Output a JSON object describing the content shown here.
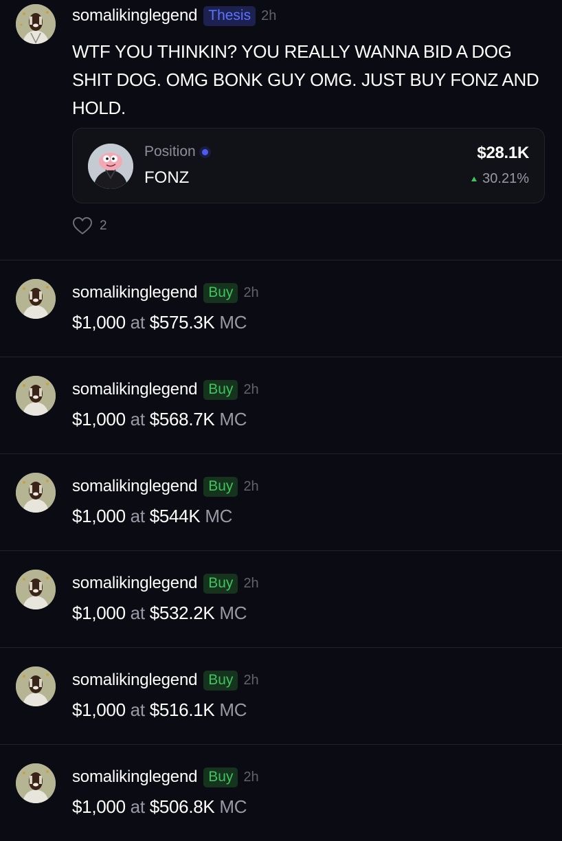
{
  "thesis_post": {
    "username": "somalikinglegend",
    "badge": "Thesis",
    "time": "2h",
    "text": "WTF YOU THINKIN? YOU REALLY WANNA BID A DOG SHIT DOG. OMG BONK GUY OMG. JUST BUY FONZ AND HOLD.",
    "position": {
      "label": "Position",
      "token": "FONZ",
      "value": "$28.1K",
      "change": "30.21%"
    },
    "likes": "2"
  },
  "trades": [
    {
      "username": "somalikinglegend",
      "badge": "Buy",
      "time": "2h",
      "amount": "$1,000",
      "at": "at",
      "mc": "$575.3K",
      "unit": "MC"
    },
    {
      "username": "somalikinglegend",
      "badge": "Buy",
      "time": "2h",
      "amount": "$1,000",
      "at": "at",
      "mc": "$568.7K",
      "unit": "MC"
    },
    {
      "username": "somalikinglegend",
      "badge": "Buy",
      "time": "2h",
      "amount": "$1,000",
      "at": "at",
      "mc": "$544K",
      "unit": "MC"
    },
    {
      "username": "somalikinglegend",
      "badge": "Buy",
      "time": "2h",
      "amount": "$1,000",
      "at": "at",
      "mc": "$532.2K",
      "unit": "MC"
    },
    {
      "username": "somalikinglegend",
      "badge": "Buy",
      "time": "2h",
      "amount": "$1,000",
      "at": "at",
      "mc": "$516.1K",
      "unit": "MC"
    },
    {
      "username": "somalikinglegend",
      "badge": "Buy",
      "time": "2h",
      "amount": "$1,000",
      "at": "at",
      "mc": "$506.8K",
      "unit": "MC"
    }
  ],
  "icons": {
    "avatar": "user-avatar",
    "token": "token-avatar",
    "like": "heart-icon",
    "status_dot": "live-dot",
    "change": "up-arrow-icon"
  },
  "colors": {
    "background": "#0b0b13",
    "thesis_badge_bg": "#1c2150",
    "thesis_badge_text": "#5d73ff",
    "buy_badge_bg": "#16341d",
    "buy_badge_text": "#3fc35d",
    "position_dot": "#4c5cf0"
  }
}
